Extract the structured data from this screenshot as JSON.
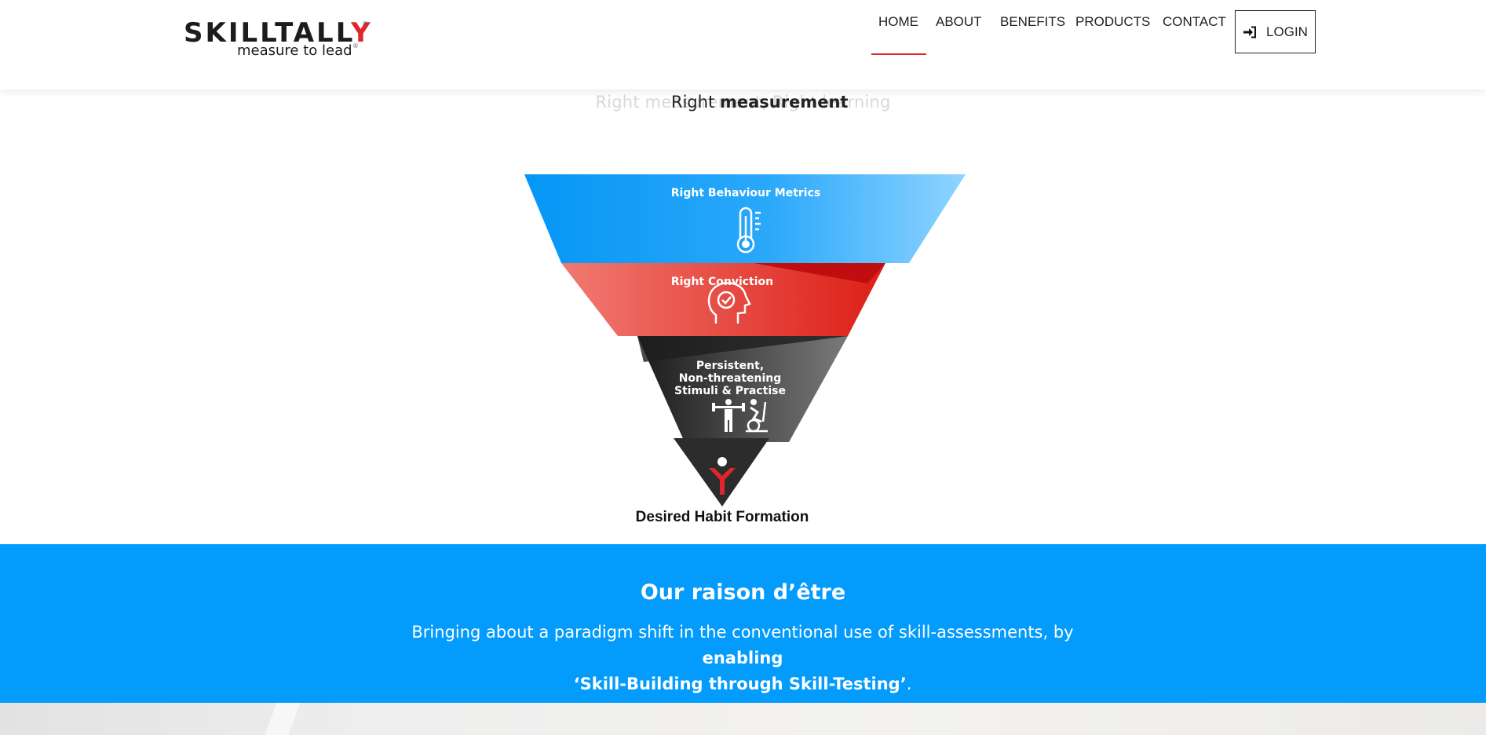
{
  "header": {
    "logo": {
      "brand_prefix": "SKILLTALL",
      "brand_suffix": "Y",
      "registered": "®",
      "tagline": "measure to lead",
      "tagline_registered": "®"
    },
    "nav": [
      {
        "label": "HOME",
        "active": true
      },
      {
        "label": "ABOUT",
        "active": false
      },
      {
        "label": "BENEFITS",
        "active": false
      },
      {
        "label": "PRODUCTS",
        "active": false
      },
      {
        "label": "CONTACT",
        "active": false
      }
    ],
    "login_label": "LOGIN",
    "login_icon": "sign-in-icon"
  },
  "hero": {
    "tagline_faded": "Right measurement, Right learning",
    "tagline_word_1": "Right ",
    "tagline_word_2": "measurement"
  },
  "pyramid": {
    "levels": [
      {
        "label": "Right Behaviour Metrics",
        "icon": "thermometer-icon",
        "color": "#1a9ff8"
      },
      {
        "label": "Right Conviction",
        "icon": "head-check-icon",
        "color": "#e4262b"
      },
      {
        "label_lines": [
          "Persistent,",
          "Non-threatening",
          "Stimuli & Practise"
        ],
        "icon": "exercise-icon",
        "color": "#3a3a3a"
      },
      {
        "label": "",
        "icon": "skilltally-y-icon",
        "color": "#2a2a2a"
      }
    ],
    "caption": "Desired Habit Formation"
  },
  "mission": {
    "title": "Our raison d’être",
    "text_plain": "Bringing about a paradigm shift in the conventional use of skill-assessments, by ",
    "text_bold_1": "enabling",
    "text_bold_2": "‘Skill-Building through Skill-Testing’",
    "text_end": ".",
    "background": "#039bfc"
  }
}
